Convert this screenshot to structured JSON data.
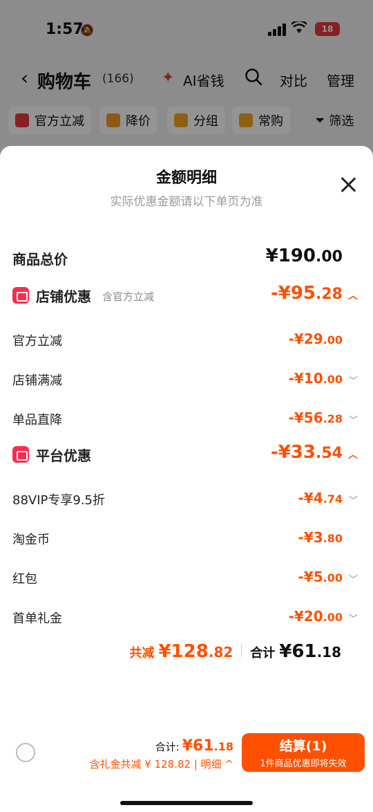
{
  "status_bar": {
    "time": "1:57",
    "battery": "18"
  },
  "header": {
    "title": "购物车",
    "count": "(166)",
    "ai_label": "AI省钱",
    "compare": "对比",
    "manage": "管理"
  },
  "chips": [
    {
      "label": "官方立减",
      "color": "#e8383d"
    },
    {
      "label": "降价",
      "color": "#f59a23"
    },
    {
      "label": "分组",
      "color": "#f5a623"
    },
    {
      "label": "常购",
      "color": "#f5a623"
    }
  ],
  "filter_label": "筛选",
  "sheet": {
    "title": "金额明细",
    "subtitle": "实际优惠金额请以下单页为准",
    "goods_total": {
      "label": "商品总价",
      "int": "¥190",
      "dec": ".00"
    },
    "shop_discount": {
      "label": "店铺优惠",
      "note": "含官方立减",
      "int": "-¥95",
      "dec": ".28"
    },
    "shop_items": [
      {
        "label": "官方立减",
        "int": "-¥29",
        "dec": ".00",
        "expand": false
      },
      {
        "label": "店铺满减",
        "int": "-¥10",
        "dec": ".00",
        "expand": true
      },
      {
        "label": "单品直降",
        "int": "-¥56",
        "dec": ".28",
        "expand": true
      }
    ],
    "platform_discount": {
      "label": "平台优惠",
      "int": "-¥33",
      "dec": ".54"
    },
    "platform_items": [
      {
        "label": "88VIP专享9.5折",
        "int": "-¥4",
        "dec": ".74",
        "expand": true
      },
      {
        "label": "淘金币",
        "int": "-¥3",
        "dec": ".80",
        "expand": false
      },
      {
        "label": "红包",
        "int": "-¥5",
        "dec": ".00",
        "expand": true
      },
      {
        "label": "首单礼金",
        "int": "-¥20",
        "dec": ".00",
        "expand": true
      }
    ],
    "summary": {
      "saved_label": "共减",
      "saved_int": "¥128",
      "saved_dec": ".82",
      "total_label": "合计",
      "total_int": "¥61",
      "total_dec": ".18"
    }
  },
  "bottom_bar": {
    "total_label": "合计:",
    "total_int": "¥61",
    "total_dec": ".18",
    "saving_text": "含礼金共减 ¥ 128.82 | 明细 ^",
    "checkout_label": "结算(1)",
    "checkout_sub": "1件商品优惠即将失效"
  },
  "colors": {
    "accent": "#ff5000",
    "badge": "#ff2b4e"
  }
}
